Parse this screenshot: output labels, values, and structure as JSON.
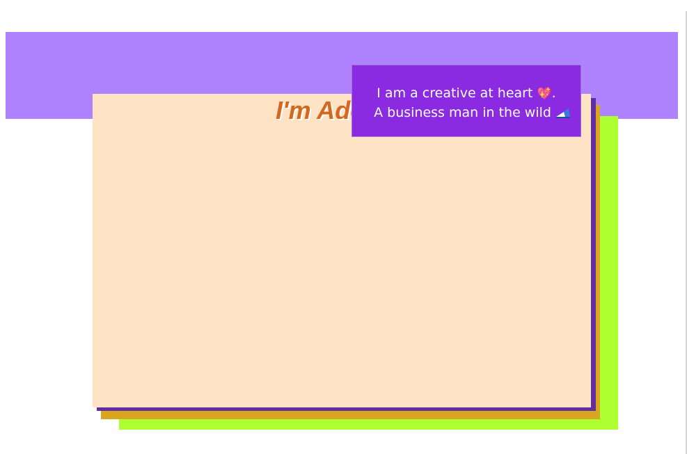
{
  "hero": {
    "title": "I'm Adeoye",
    "tooltip_line1": "I am a creative at heart",
    "tooltip_line1_end": ".",
    "tooltip_line2": "A business man in the wild",
    "heart_emoji": "💖",
    "wave_icon": "wave-icon"
  },
  "colors": {
    "banner": "#af82ff",
    "card": "#ffe3c4",
    "title": "#d2691e",
    "tooltip": "#8a2be2",
    "shadow_purple": "#5f2fa0",
    "shadow_orange": "#daa520",
    "shadow_green": "#adff2f"
  }
}
